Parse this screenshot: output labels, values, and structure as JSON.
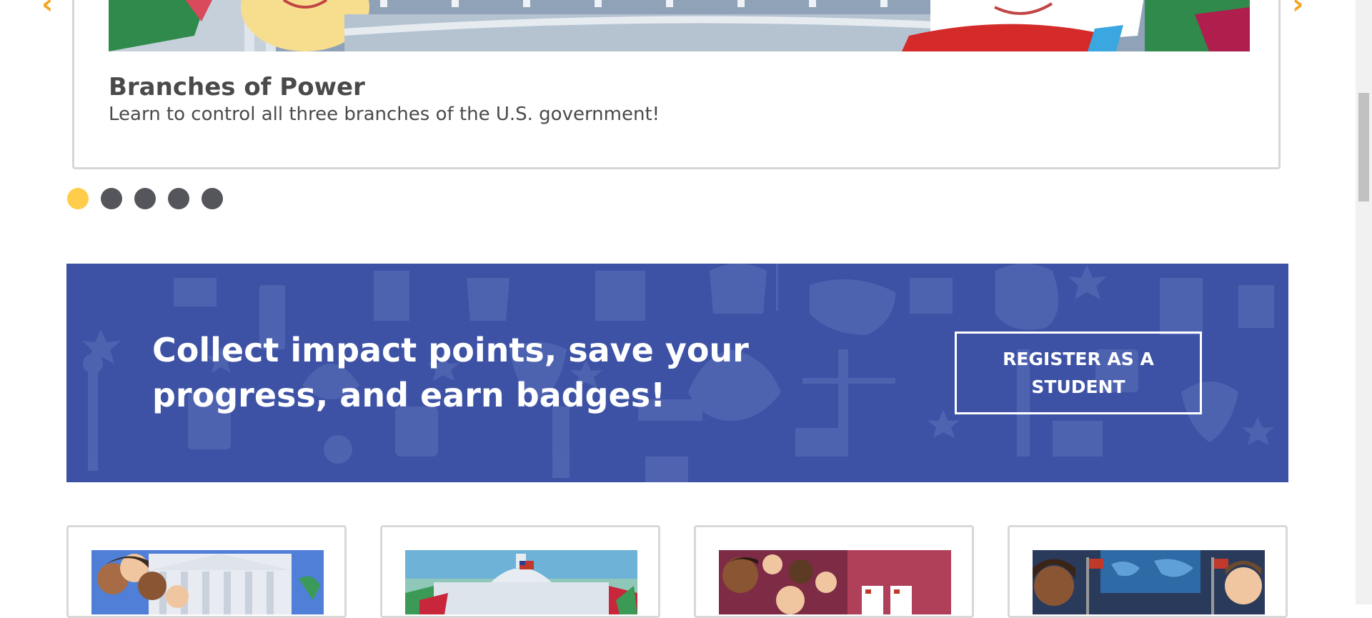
{
  "carousel": {
    "prev_icon": "chevron-left-icon",
    "next_icon": "chevron-right-icon",
    "slide": {
      "title": "Branches of Power",
      "description": "Learn to control all three branches of the U.S. government!"
    },
    "slide_count": 5,
    "active_slide": 1,
    "colors": {
      "active_dot": "#ffcd4a",
      "inactive_dot": "#55555c",
      "arrow": "#f6a623"
    }
  },
  "banner": {
    "heading": "Collect impact points, save your progress, and earn badges!",
    "button_label": "REGISTER AS A STUDENT",
    "background_color": "#3d52a5"
  },
  "game_cards": [
    {
      "image": "supreme-court-characters-image"
    },
    {
      "image": "capitol-building-image"
    },
    {
      "image": "election-voting-booths-image"
    },
    {
      "image": "news-studio-hosts-image"
    }
  ]
}
